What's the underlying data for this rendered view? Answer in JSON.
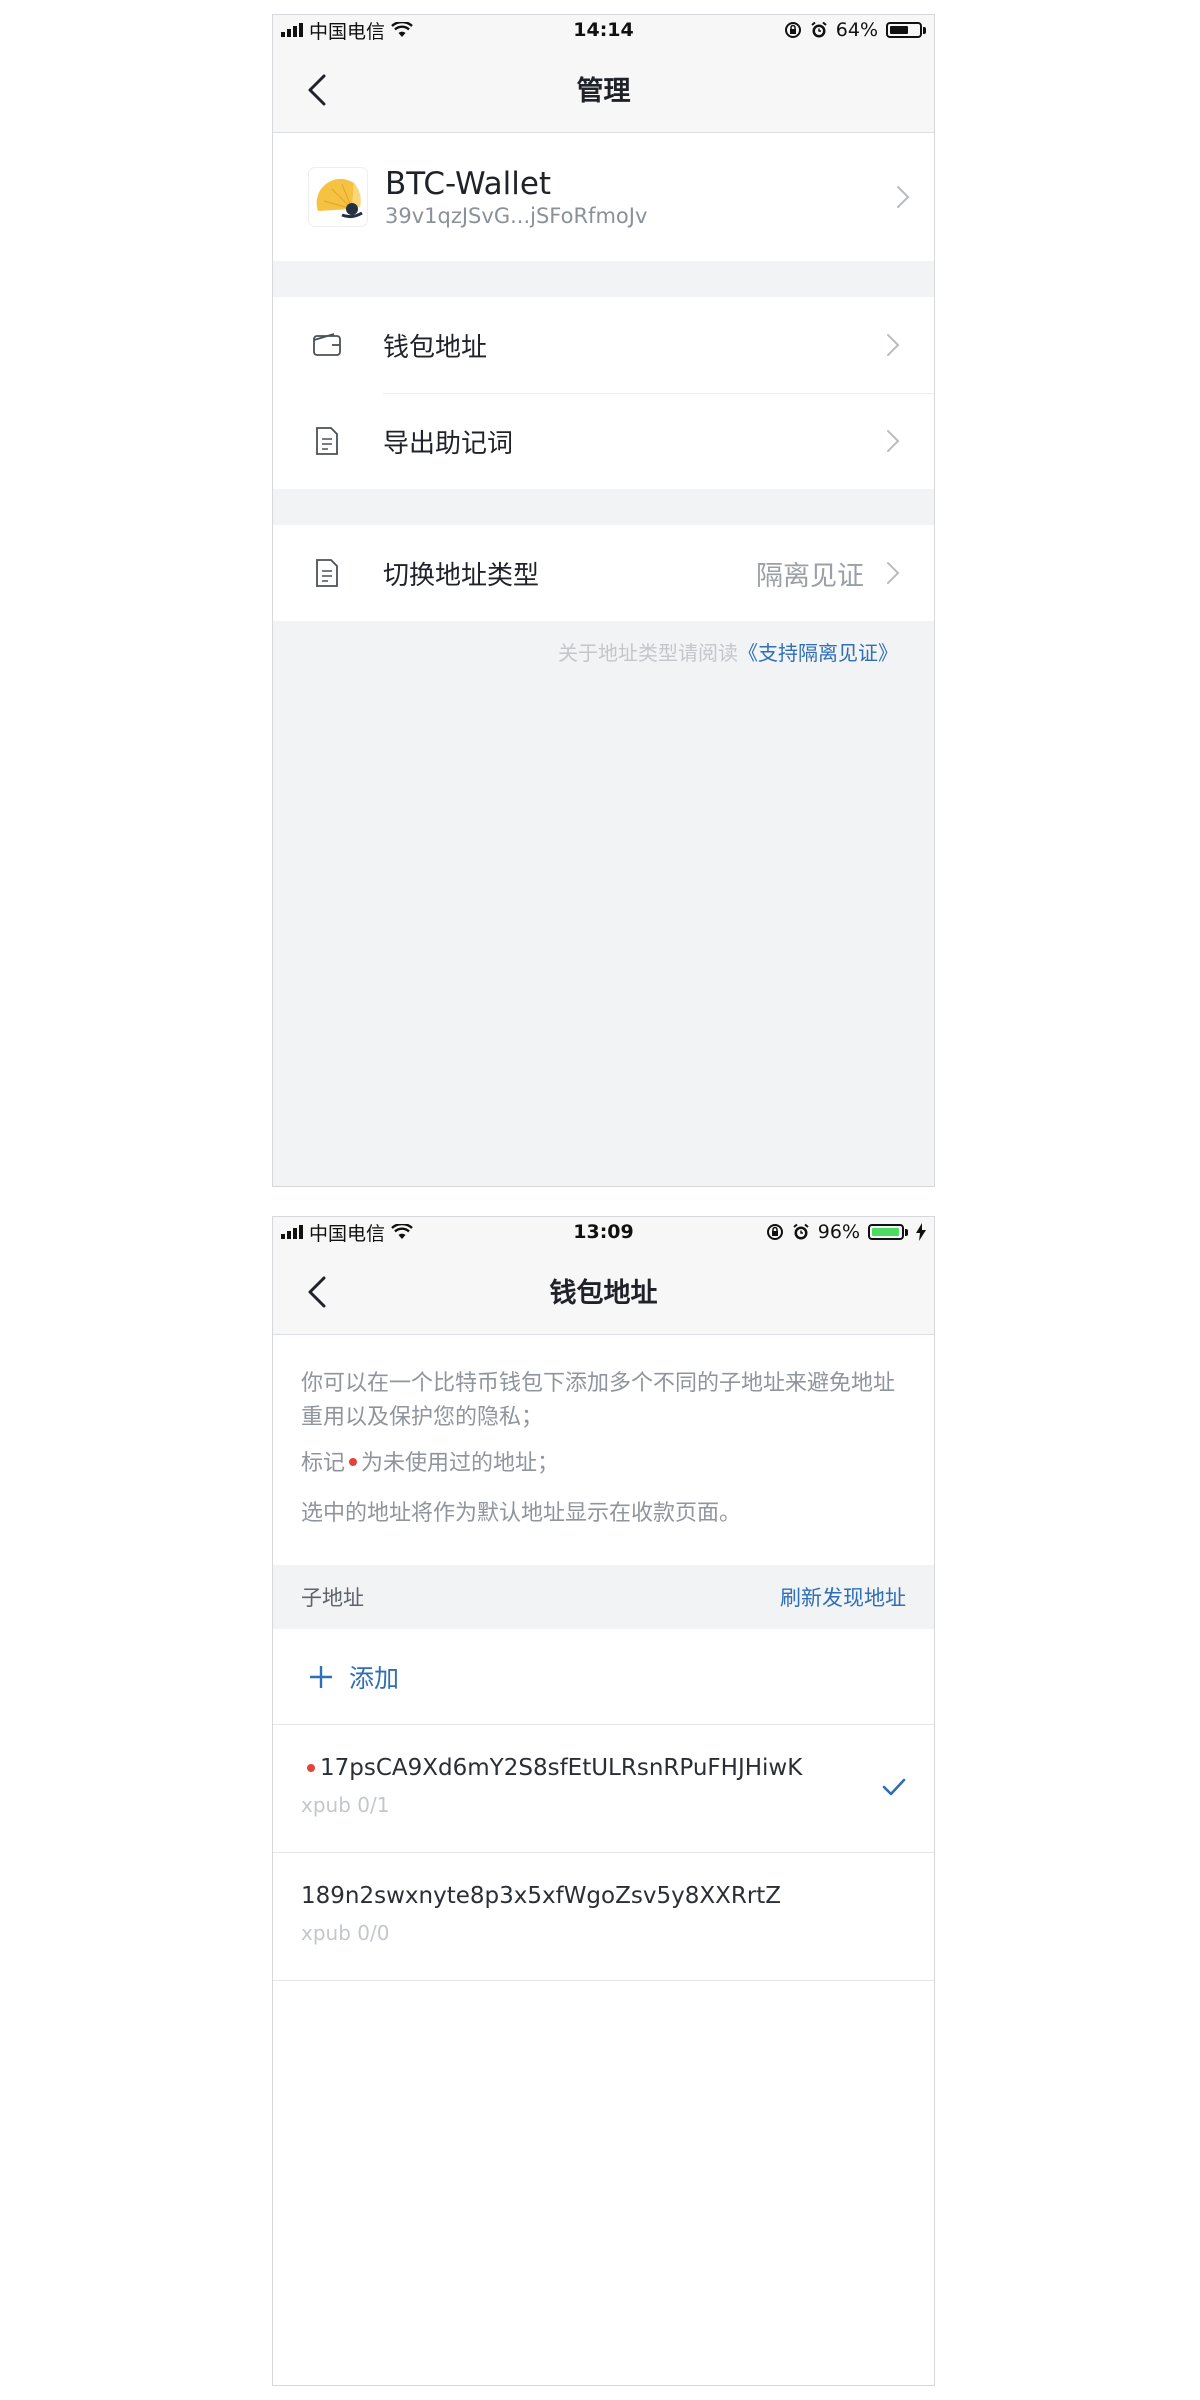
{
  "screen1": {
    "status": {
      "carrier": "中国电信",
      "time": "14:14",
      "battery": "64%"
    },
    "title": "管理",
    "wallet": {
      "name": "BTC-Wallet",
      "address": "39v1qzJSvG...jSFoRfmoJv"
    },
    "menu": [
      {
        "label": "钱包地址",
        "icon": "wallet-icon"
      },
      {
        "label": "导出助记词",
        "icon": "document-icon"
      }
    ],
    "switch_row": {
      "label": "切换地址类型",
      "value": "隔离见证",
      "icon": "document-icon"
    },
    "footnote": {
      "text": "关于地址类型请阅读",
      "link": "《支持隔离见证》"
    }
  },
  "screen2": {
    "status": {
      "carrier": "中国电信",
      "time": "13:09",
      "battery": "96%"
    },
    "title": "钱包地址",
    "info": {
      "line1": "你可以在一个比特币钱包下添加多个不同的子地址来避免地址重用以及保护您的隐私；",
      "line2_prefix": "标记",
      "line2_suffix": "为未使用过的地址；",
      "line3": "选中的地址将作为默认地址显示在收款页面。"
    },
    "section": {
      "title": "子地址",
      "action": "刷新发现地址"
    },
    "add_label": "添加",
    "addresses": [
      {
        "address": "17psCA9Xd6mY2S8sfEtULRsnRPuFHJHiwK",
        "path": "xpub 0/1",
        "unused": true,
        "selected": true
      },
      {
        "address": "189n2swxnyte8p3x5xfWgoZsv5y8XXRrtZ",
        "path": "xpub 0/0",
        "unused": false,
        "selected": false
      }
    ]
  },
  "colors": {
    "accent": "#2f6fb6",
    "unused_dot": "#e0443a",
    "battery_green": "#4cd964",
    "page_gray": "#f2f3f5"
  }
}
